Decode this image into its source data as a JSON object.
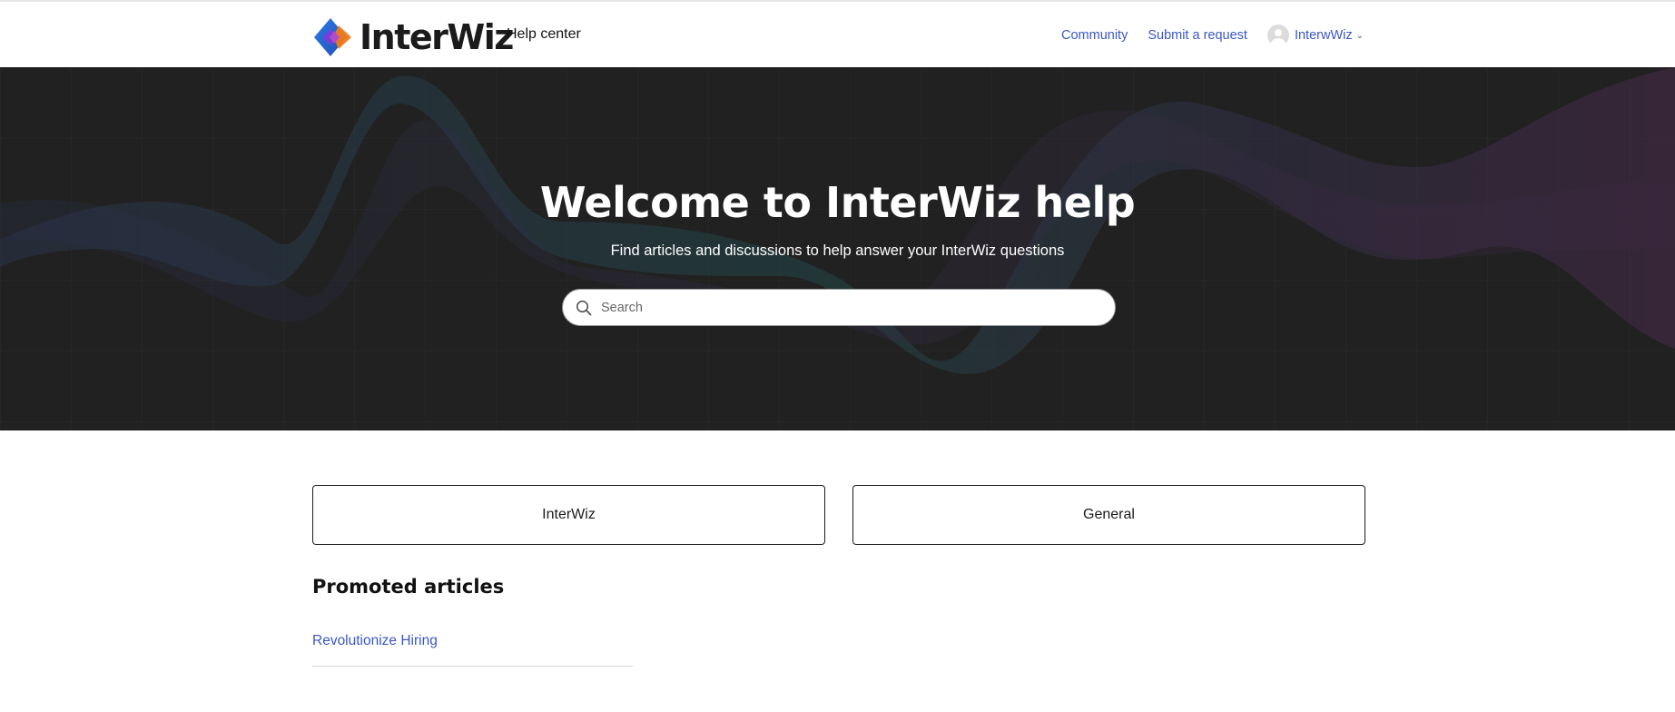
{
  "header": {
    "logo_text": "InterWiz",
    "help_center": "Help center",
    "nav": {
      "community": "Community",
      "submit_request": "Submit a request",
      "user_name": "InterwWiz"
    }
  },
  "hero": {
    "title": "Welcome to InterWiz help",
    "subtitle": "Find articles and discussions to help answer your InterWiz questions",
    "search_placeholder": "Search"
  },
  "categories": [
    {
      "label": "InterWiz"
    },
    {
      "label": "General"
    }
  ],
  "promoted": {
    "heading": "Promoted articles",
    "articles": [
      {
        "title": "Revolutionize Hiring"
      }
    ]
  },
  "colors": {
    "link": "#3b57c4",
    "hero_bg": "#212121",
    "logo_blue": "#2f6fe0",
    "logo_purple": "#8a3fd1",
    "logo_orange": "#f07a1a"
  }
}
